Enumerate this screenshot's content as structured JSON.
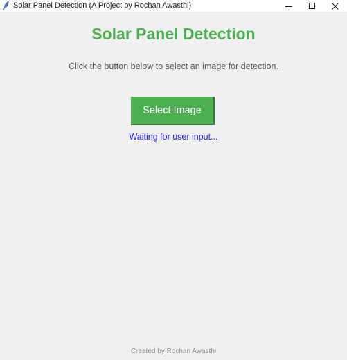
{
  "window": {
    "title": "Solar Panel Detection (A Project by Rochan Awasthi)",
    "app_icon": "feather-icon",
    "controls": {
      "minimize_icon": "minimize-icon",
      "maximize_icon": "maximize-icon",
      "close_icon": "close-icon"
    }
  },
  "main": {
    "heading": "Solar Panel Detection",
    "instruction": "Click the button below to select an image for detection.",
    "select_button_label": "Select Image",
    "status": "Waiting for user input...",
    "footer": "Created by Rochan Awasthi"
  },
  "colors": {
    "accent": "#4caf50",
    "status_text": "#1f1ff0",
    "background": "#f0f0f0"
  }
}
